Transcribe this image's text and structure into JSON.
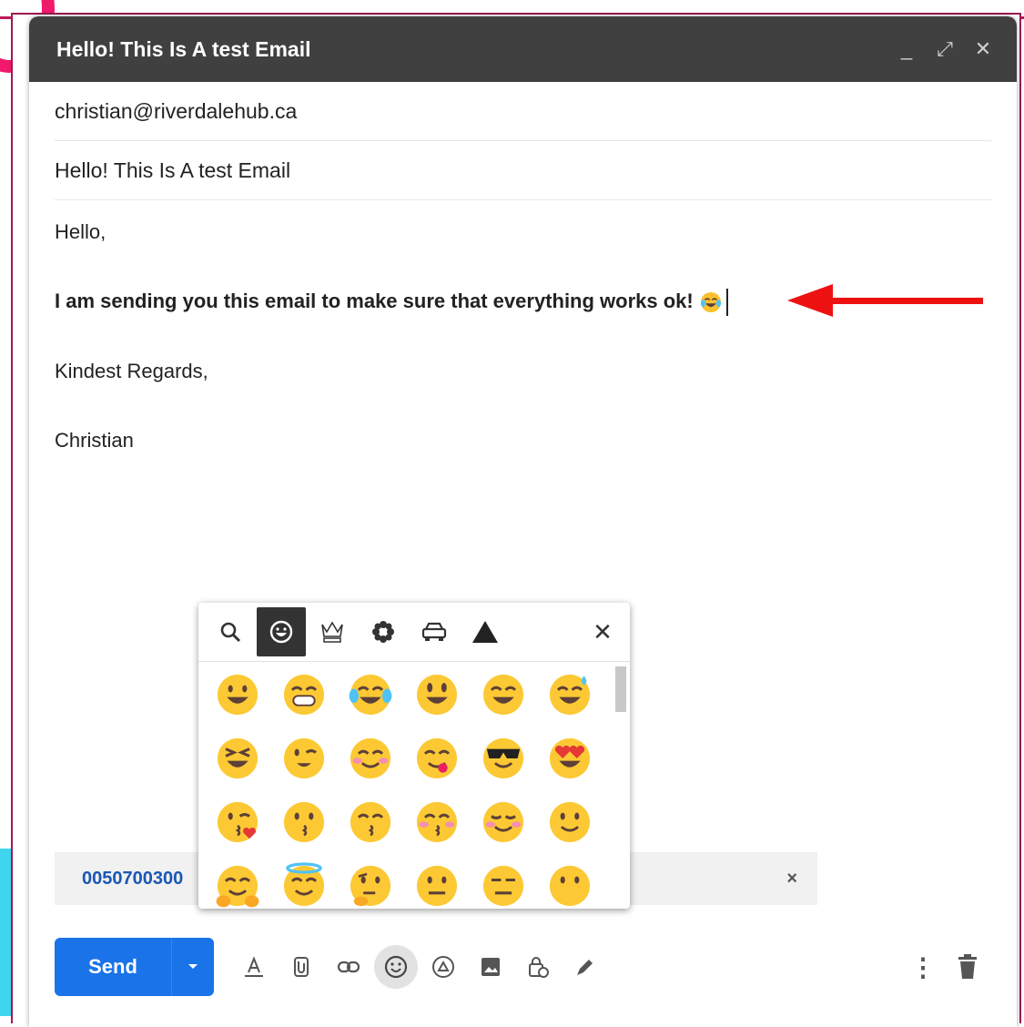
{
  "window": {
    "title": "Hello! This Is A test Email",
    "controls": {
      "minimize": "_",
      "expand": "⤢",
      "close": "✕"
    }
  },
  "fields": {
    "to": "christian@riverdalehub.ca",
    "subject": "Hello! This Is A test Email"
  },
  "body": {
    "greeting": "Hello,",
    "message": "I am sending you this email to make sure that everything works ok!",
    "closing": "Kindest Regards,",
    "signature": "Christian"
  },
  "attachment": {
    "name": "0050700300",
    "remove": "×"
  },
  "toolbar": {
    "send_label": "Send",
    "icons": [
      "format-text-icon",
      "attach-icon",
      "link-icon",
      "emoji-icon",
      "drive-icon",
      "photo-icon",
      "confidential-icon",
      "signature-icon"
    ],
    "more": "⋮"
  },
  "emoji_picker": {
    "tabs": [
      "search-icon",
      "smileys-icon",
      "people-icon",
      "nature-icon",
      "travel-icon",
      "symbols-icon"
    ],
    "close": "✕",
    "rows": [
      [
        "grinning",
        "beaming",
        "tears-of-joy",
        "smiley",
        "smile",
        "sweat-smile"
      ],
      [
        "squinting",
        "winking",
        "blush",
        "yum",
        "sunglasses",
        "heart-eyes"
      ],
      [
        "kissing-heart",
        "kissing",
        "kissing-smile",
        "kissing-closed",
        "relaxed",
        "slight-smile"
      ],
      [
        "hugging",
        "innocent",
        "thinking",
        "neutral",
        "expressionless",
        "no-mouth"
      ]
    ]
  },
  "colors": {
    "titlebar": "#404040",
    "send": "#1a73e8",
    "arrow": "#ee1111",
    "link": "#1a57b5"
  }
}
